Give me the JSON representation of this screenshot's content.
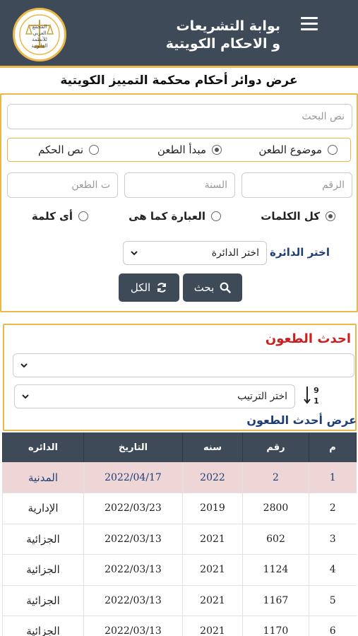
{
  "header": {
    "title_line1": "بوابة التشريعات",
    "title_line2": "و الاحكام الكويتية",
    "logo_text": [
      "المجمع",
      "العربي",
      "للأنظمة",
      "القانونية"
    ]
  },
  "page_title": "عرض دوائر أحكام محكمة التمييز الكويتية",
  "search": {
    "search_placeholder": "نص البحث",
    "search_in_options": [
      {
        "label": "موضوع الطعن",
        "selected": false
      },
      {
        "label": "مبدأ الطعن",
        "selected": true
      },
      {
        "label": "نص الحكم",
        "selected": false
      }
    ],
    "number_placeholder": "الرقم",
    "year_placeholder": "السنة",
    "type_placeholder": "ت الطعن",
    "match_options": [
      {
        "label": "كل الكلمات",
        "selected": true
      },
      {
        "label": "العبارة كما هى",
        "selected": false
      },
      {
        "label": "أى كلمة",
        "selected": false
      }
    ],
    "circuit_label": "اختر الدائرة",
    "circuit_select_value": "اختر الدائرة",
    "search_button": "بحث",
    "all_button": "الكل"
  },
  "latest": {
    "title": "احدث الطعون",
    "filter_value": "",
    "sort_value": "اختر الترتيب",
    "show_label": "عرض أحدث الطعون"
  },
  "table": {
    "headers": [
      "م",
      "رقم",
      "سنه",
      "التاريخ",
      "الدائره"
    ],
    "rows": [
      [
        "1",
        "2",
        "2022",
        "2022/04/17",
        "المدنية"
      ],
      [
        "2",
        "2800",
        "2019",
        "2022/03/23",
        "الإدارية"
      ],
      [
        "3",
        "602",
        "2021",
        "2022/03/13",
        "الجزائية"
      ],
      [
        "4",
        "1124",
        "2021",
        "2022/03/13",
        "الجزائية"
      ],
      [
        "5",
        "1167",
        "2021",
        "2022/03/13",
        "الجزائية"
      ],
      [
        "6",
        "1170",
        "2021",
        "2022/03/13",
        "الجزائية"
      ]
    ]
  },
  "colors": {
    "header_bg": "#3f4a59",
    "accent_gold": "#e9b84a",
    "title_red": "#cc1f1f",
    "link_blue": "#1f3e78",
    "highlight_row": "#efd6d6"
  }
}
